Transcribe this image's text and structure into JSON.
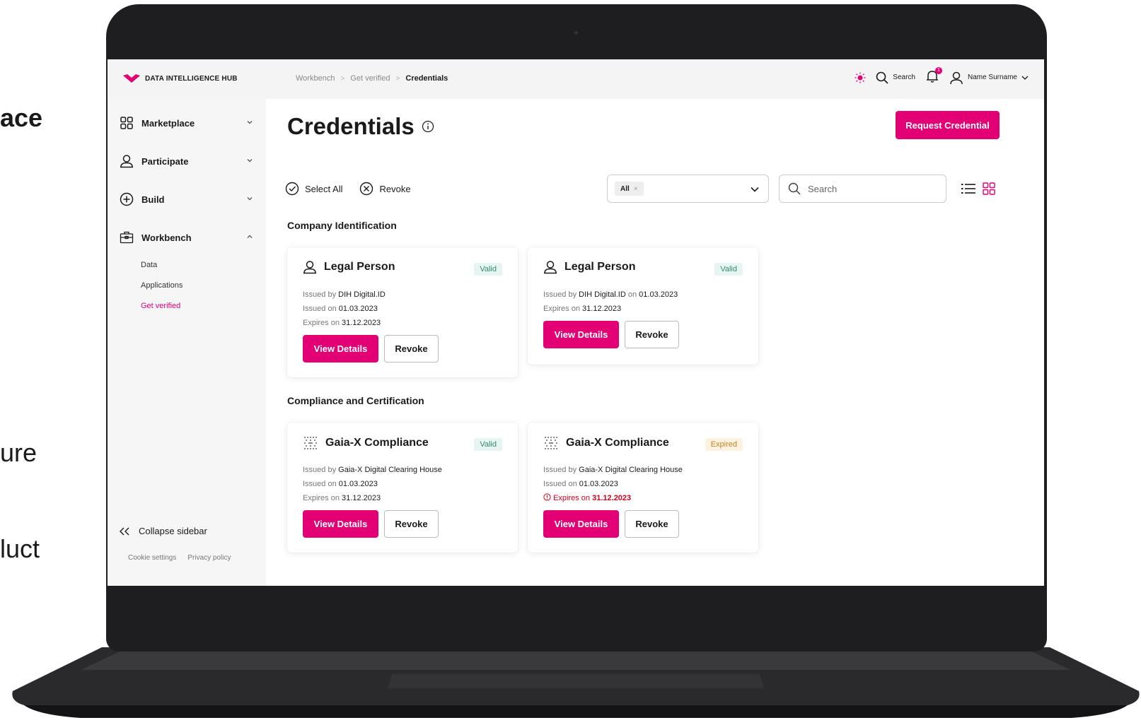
{
  "side_fragments": [
    "ace",
    "ure",
    "luct"
  ],
  "brand": {
    "name": "DATA INTELLIGENCE HUB",
    "accent": "#e20074"
  },
  "breadcrumb": [
    "Workbench",
    "Get verified",
    "Credentials"
  ],
  "topbar": {
    "search_label": "Search",
    "notification_count": "1",
    "user_name": "Name Surname"
  },
  "sidebar": {
    "items": [
      {
        "label": "Marketplace",
        "icon": "grid-icon"
      },
      {
        "label": "Participate",
        "icon": "person-icon"
      },
      {
        "label": "Build",
        "icon": "plus-circle-icon"
      },
      {
        "label": "Workbench",
        "icon": "briefcase-icon"
      }
    ],
    "sub_items": [
      "Data",
      "Applications",
      "Get verified"
    ],
    "collapse_label": "Collapse sidebar",
    "footer_links": [
      "Cookie settings",
      "Privacy policy"
    ]
  },
  "page": {
    "title": "Credentials",
    "request_button": "Request Credential",
    "select_all": "Select All",
    "revoke_all": "Revoke",
    "filter_chip": "All",
    "search_placeholder": "Search"
  },
  "sections": [
    {
      "title": "Company Identification",
      "cards": [
        {
          "title": "Legal Person",
          "status": "Valid",
          "issued_by_label": "Issued by",
          "issuer": "DIH Digital.ID",
          "issued_on_label": "Issued on",
          "issued_on": "01.03.2023",
          "expires_label": "Expires on",
          "expires": "31.12.2023",
          "view": "View Details",
          "revoke": "Revoke"
        },
        {
          "title": "Legal Person",
          "status": "Valid",
          "issued_by_label": "Issued by",
          "issuer": "DIH Digital.ID",
          "on_label": "on",
          "issued_on": "01.03.2023",
          "expires_label": "Expires on",
          "expires": "31.12.2023",
          "view": "View Details",
          "revoke": "Revoke"
        }
      ]
    },
    {
      "title": "Compliance and Certification",
      "cards": [
        {
          "title": "Gaia-X Compliance",
          "status": "Valid",
          "issued_by_label": "Issued by",
          "issuer": "Gaia-X Digital Clearing House",
          "issued_on_label": "Issued on",
          "issued_on": "01.03.2023",
          "expires_label": "Expires on",
          "expires": "31.12.2023",
          "view": "View Details",
          "revoke": "Revoke"
        },
        {
          "title": "Gaia-X Compliance",
          "status": "Expired",
          "issued_by_label": "Issued by",
          "issuer": "Gaia-X Digital Clearing House",
          "issued_on_label": "Issued on",
          "issued_on": "01.03.2023",
          "expires_label": "Expires on",
          "expires": "31.12.2023",
          "view": "View Details",
          "revoke": "Revoke"
        }
      ]
    }
  ]
}
